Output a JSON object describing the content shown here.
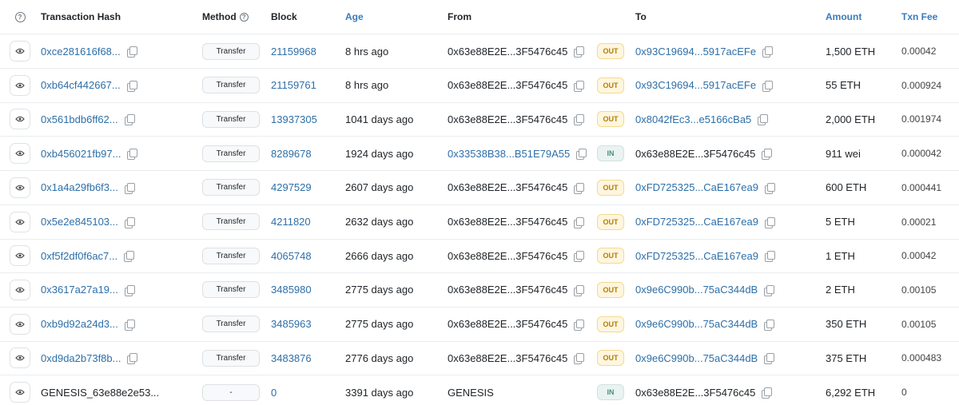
{
  "header": {
    "help_glyph": "?",
    "hash": "Transaction Hash",
    "method": "Method",
    "block": "Block",
    "age": "Age",
    "from": "From",
    "to": "To",
    "amount": "Amount",
    "fee": "Txn Fee"
  },
  "rows": [
    {
      "hash": "0xce281616f68...",
      "method": "Transfer",
      "block": "21159968",
      "age": "8 hrs ago",
      "from": "0x63e88E2E...3F5476c45",
      "from_link": false,
      "dir": "OUT",
      "to": "0x93C19694...5917acEFe",
      "to_link": true,
      "amount": "1,500 ETH",
      "fee": "0.00042"
    },
    {
      "hash": "0xb64cf442667...",
      "method": "Transfer",
      "block": "21159761",
      "age": "8 hrs ago",
      "from": "0x63e88E2E...3F5476c45",
      "from_link": false,
      "dir": "OUT",
      "to": "0x93C19694...5917acEFe",
      "to_link": true,
      "amount": "55 ETH",
      "fee": "0.000924"
    },
    {
      "hash": "0x561bdb6ff62...",
      "method": "Transfer",
      "block": "13937305",
      "age": "1041 days ago",
      "from": "0x63e88E2E...3F5476c45",
      "from_link": false,
      "dir": "OUT",
      "to": "0x8042fEc3...e5166cBa5",
      "to_link": true,
      "amount": "2,000 ETH",
      "fee": "0.001974"
    },
    {
      "hash": "0xb456021fb97...",
      "method": "Transfer",
      "block": "8289678",
      "age": "1924 days ago",
      "from": "0x33538B38...B51E79A55",
      "from_link": true,
      "dir": "IN",
      "to": "0x63e88E2E...3F5476c45",
      "to_link": false,
      "amount": "911 wei",
      "fee": "0.000042"
    },
    {
      "hash": "0x1a4a29fb6f3...",
      "method": "Transfer",
      "block": "4297529",
      "age": "2607 days ago",
      "from": "0x63e88E2E...3F5476c45",
      "from_link": false,
      "dir": "OUT",
      "to": "0xFD725325...CaE167ea9",
      "to_link": true,
      "amount": "600 ETH",
      "fee": "0.000441"
    },
    {
      "hash": "0x5e2e845103...",
      "method": "Transfer",
      "block": "4211820",
      "age": "2632 days ago",
      "from": "0x63e88E2E...3F5476c45",
      "from_link": false,
      "dir": "OUT",
      "to": "0xFD725325...CaE167ea9",
      "to_link": true,
      "amount": "5 ETH",
      "fee": "0.00021"
    },
    {
      "hash": "0xf5f2df0f6ac7...",
      "method": "Transfer",
      "block": "4065748",
      "age": "2666 days ago",
      "from": "0x63e88E2E...3F5476c45",
      "from_link": false,
      "dir": "OUT",
      "to": "0xFD725325...CaE167ea9",
      "to_link": true,
      "amount": "1 ETH",
      "fee": "0.00042"
    },
    {
      "hash": "0x3617a27a19...",
      "method": "Transfer",
      "block": "3485980",
      "age": "2775 days ago",
      "from": "0x63e88E2E...3F5476c45",
      "from_link": false,
      "dir": "OUT",
      "to": "0x9e6C990b...75aC344dB",
      "to_link": true,
      "amount": "2 ETH",
      "fee": "0.00105"
    },
    {
      "hash": "0xb9d92a24d3...",
      "method": "Transfer",
      "block": "3485963",
      "age": "2775 days ago",
      "from": "0x63e88E2E...3F5476c45",
      "from_link": false,
      "dir": "OUT",
      "to": "0x9e6C990b...75aC344dB",
      "to_link": true,
      "amount": "350 ETH",
      "fee": "0.00105"
    },
    {
      "hash": "0xd9da2b73f8b...",
      "method": "Transfer",
      "block": "3483876",
      "age": "2776 days ago",
      "from": "0x63e88E2E...3F5476c45",
      "from_link": false,
      "dir": "OUT",
      "to": "0x9e6C990b...75aC344dB",
      "to_link": true,
      "amount": "375 ETH",
      "fee": "0.000483"
    },
    {
      "hash": "GENESIS_63e88e2e53...",
      "hash_link": false,
      "method": "-",
      "block": "0",
      "age": "3391 days ago",
      "from": "GENESIS",
      "from_link": false,
      "from_copy": false,
      "dir": "IN",
      "to": "0x63e88E2E...3F5476c45",
      "to_link": false,
      "amount": "6,292 ETH",
      "fee": "0"
    }
  ],
  "colors": {
    "link": "#2d6fa8",
    "out_badge": "#fff6e0",
    "in_badge": "#eaf3f1"
  },
  "icons": {
    "help": "help-circle-icon",
    "view": "eye-icon",
    "copy": "copy-icon"
  }
}
